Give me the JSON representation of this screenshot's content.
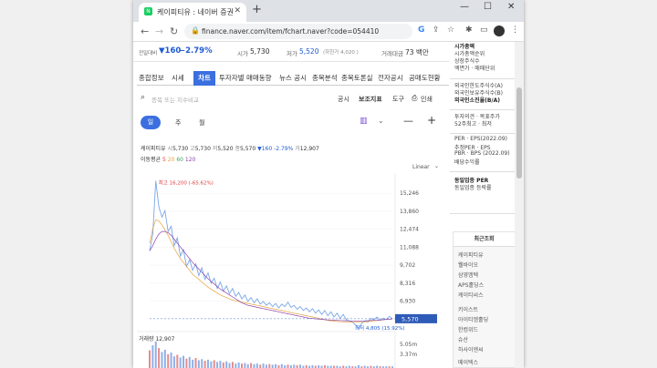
{
  "browser": {
    "tab_title": "케이피티유 : 네이버 증권",
    "favicon_letter": "N",
    "url": "finance.naver.com/item/fchart.naver?code=054410",
    "window_controls": [
      "—",
      "☐",
      "✕"
    ]
  },
  "header": {
    "prev_day_label": "전일대비",
    "change_value": "▼160",
    "change_pct": "−2.79%",
    "market_cap_label": "시가",
    "open_value": "5,730",
    "low_label": "저가",
    "low_value": "5,520",
    "low_limit": "(하한가 4,020 )",
    "volume_amount_label": "거래대금",
    "volume_amount_value": "73 백만"
  },
  "nav_tabs": [
    "종합정보",
    "시세",
    "차트",
    "투자자별 매매동향",
    "뉴스 공시",
    "종목분석",
    "종목토론실",
    "전자공시",
    "공매도현황"
  ],
  "chart_toolbar": {
    "search_placeholder": "종목 또는 지수비교",
    "links": [
      "공시",
      "보조지표",
      "도구",
      "인쇄"
    ],
    "periods": [
      "일",
      "주",
      "월"
    ]
  },
  "quote": {
    "name": "케이피티유",
    "open_label": "시",
    "open": "5,730",
    "high_label": "고",
    "high": "5,730",
    "low_label": "저",
    "low": "5,520",
    "close_label": "종",
    "close": "5,570",
    "change": "▼160",
    "pct": "-2.79%",
    "vol_label": "거",
    "volume": "12,907"
  },
  "ma": {
    "label": "이동평균",
    "periods": [
      "5",
      "20",
      "60",
      "120"
    ]
  },
  "scale_label": "Linear",
  "chart_data": {
    "type": "line",
    "title": "케이피티유",
    "y_ticks": [
      "15,246",
      "13,860",
      "12,474",
      "11,088",
      "9,702",
      "8,316",
      "6,930",
      "5,570"
    ],
    "ylim": [
      5000,
      16800
    ],
    "max_label": "최고 16,200 (-65.62%)",
    "min_label": "최저 4,805 (15.92%)",
    "current_value": 5570,
    "series": [
      {
        "color": "#7aa7e8",
        "values": [
          10800,
          12100,
          16200,
          14200,
          13400,
          13900,
          12300,
          12700,
          11200,
          11800,
          10400,
          10900,
          9600,
          10100,
          9300,
          9800,
          8900,
          9500,
          8600,
          9100,
          8300,
          8700,
          7900,
          8400,
          7700,
          8100,
          7500,
          7900,
          7300,
          7600,
          7100,
          7400,
          6900,
          7200,
          6800,
          7100,
          6700,
          6900,
          6600,
          6800,
          6500,
          6750,
          6400,
          6700,
          6500,
          6850,
          6450,
          6600,
          6300,
          6500,
          6200,
          6400,
          6100,
          6350,
          6000,
          6250,
          5900,
          6200,
          5800,
          6100,
          5700,
          6000,
          5600,
          5900,
          5500,
          5400,
          5300,
          5100,
          4805,
          5200,
          5400,
          5300,
          5600,
          5500,
          5700,
          5450,
          5600,
          5500,
          5750,
          5570
        ]
      },
      {
        "color": "#e6a23c",
        "values": [
          11400,
          12500,
          13200,
          13100,
          12800,
          12400,
          12000,
          11500,
          11000,
          10600,
          10200,
          9900,
          9600,
          9300,
          9000,
          8800,
          8600,
          8400,
          8200,
          8000,
          7850,
          7700,
          7550,
          7400,
          7300,
          7200,
          7100,
          7000,
          6950,
          6900,
          6850,
          6800,
          6750,
          6700,
          6650,
          6600,
          6550,
          6500,
          6450,
          6400,
          6350,
          6300,
          6250,
          6200,
          6150,
          6100,
          6050,
          6000,
          5950,
          5900,
          5850,
          5800,
          5750,
          5700,
          5650,
          5600,
          5550,
          5500,
          5450,
          5400,
          5380,
          5360,
          5340,
          5330,
          5320,
          5310,
          5300,
          5300,
          5300,
          5310,
          5330,
          5350,
          5380,
          5400,
          5430,
          5460,
          5490,
          5510,
          5540,
          5560
        ]
      },
      {
        "color": "#8e44ad",
        "values": [
          10800,
          11200,
          11700,
          12100,
          12300,
          12300,
          12200,
          12000,
          11700,
          11400,
          11100,
          10800,
          10500,
          10200,
          9900,
          9650,
          9400,
          9150,
          8900,
          8650,
          8450,
          8250,
          8050,
          7850,
          7700,
          7550,
          7400,
          7250,
          7100,
          6950,
          6800,
          6700,
          6600,
          6550,
          6500,
          6450,
          6400,
          6350,
          6300,
          6250,
          6200,
          6150,
          6100,
          6050,
          6000,
          5950,
          5900,
          5850,
          5800,
          5750,
          5700,
          5650,
          5600,
          5580,
          5560,
          5540,
          5520,
          5500,
          5480,
          5460,
          5450,
          5440,
          5430,
          5420,
          5420,
          5410,
          5400,
          5400,
          5400,
          5400,
          5410,
          5420,
          5430,
          5440,
          5450,
          5470,
          5490,
          5510,
          5530,
          5550
        ]
      }
    ],
    "volume_label": "거래량 12,907",
    "volume_ticks": [
      "5.05m",
      "3.37m"
    ],
    "volume": [
      3.2,
      4.1,
      4.8,
      3.6,
      2.9,
      3.3,
      2.5,
      2.8,
      2.1,
      2.4,
      1.9,
      2.2,
      1.7,
      2.0,
      1.5,
      1.8,
      1.4,
      1.6,
      1.3,
      1.5,
      1.2,
      1.4,
      1.1,
      1.3,
      1.0,
      1.2,
      0.9,
      1.1,
      0.8,
      1.0,
      0.8,
      0.9,
      0.7,
      0.9,
      0.7,
      0.8,
      0.6,
      0.8,
      0.6,
      0.7,
      0.6,
      0.7,
      0.5,
      0.7,
      0.5,
      0.6,
      0.5,
      0.6,
      0.5,
      0.6,
      0.4,
      0.5,
      0.4,
      0.5,
      0.4,
      0.5,
      0.4,
      0.5,
      0.4,
      0.4,
      0.4,
      0.4,
      0.3,
      0.4,
      0.3,
      0.4,
      0.3,
      0.3,
      0.5,
      0.3,
      0.4,
      0.3,
      0.4,
      0.3,
      0.4,
      0.3,
      0.3,
      0.3,
      0.3,
      0.3
    ]
  },
  "sidebar": {
    "lines1": [
      "시가총액",
      "시가총액순위",
      "상장주식수",
      "액면가 · 매매단위"
    ],
    "lines2": [
      "외국인한도주식수(A)",
      "외국인보유주식수(B)",
      "외국인소진율(B/A)"
    ],
    "lines3": [
      "투자의견 · 목표주가",
      "52주최고 · 최저"
    ],
    "lines4": [
      "PER · EPS(2022.09)",
      "추정PER · EPS",
      "PBR · BPS (2022.09)",
      "배당수익률"
    ],
    "lines5": [
      "동일업종 PER",
      "동일업종 등락률"
    ],
    "recent_title": "최근조회",
    "recent_items": [
      "케이피티유",
      "웰바이오",
      "삼영엠텍",
      "APS홀딩스",
      "케이티씨스",
      "키이스트",
      "아이티엠홀딩",
      "한컴위드",
      "슈산",
      "하사이엔씨",
      "메이텍스"
    ]
  },
  "colors": {
    "accent": "#3b6fe0",
    "down": "#1f5bd1",
    "up": "#e03c3c"
  }
}
